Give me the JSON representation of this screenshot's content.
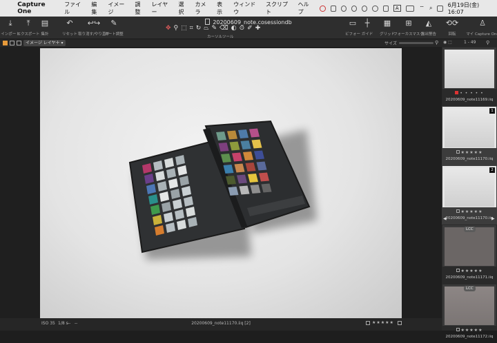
{
  "menubar": {
    "app_name": "Capture One",
    "menus": [
      "ファイル",
      "編集",
      "イメージ",
      "調整",
      "レイヤー",
      "選択",
      "カメラ",
      "表示",
      "ウィンドウ",
      "スクリプト",
      "ヘルプ"
    ],
    "ime": "A",
    "datetime": "6月19日(金)  16:07"
  },
  "toolbar": {
    "document_title": "20200609_note.cosessiondb",
    "left_tools": [
      {
        "label": "インポート",
        "icon": "import-icon"
      },
      {
        "label": "エクスポート",
        "icon": "export-icon"
      },
      {
        "label": "集計",
        "icon": "batch-icon"
      },
      {
        "label": "リセット",
        "icon": "reset-icon"
      },
      {
        "label": "取り消す/やり直す",
        "icon": "undo-redo-icon"
      },
      {
        "label": "オート調整",
        "icon": "auto-adjust-icon"
      }
    ],
    "cursor_tools_label": "カーソルツール",
    "right_tools": [
      {
        "label": "ビフォー",
        "icon": "before-icon"
      },
      {
        "label": "ガイド",
        "icon": "guide-icon"
      },
      {
        "label": "グリッド",
        "icon": "grid-icon"
      },
      {
        "label": "フォーカスマスク",
        "icon": "focus-mask-icon"
      },
      {
        "label": "露出警告",
        "icon": "exposure-warning-icon"
      },
      {
        "label": "回転",
        "icon": "rotate-icon"
      },
      {
        "label": "マイ Capture One",
        "icon": "user-icon"
      }
    ]
  },
  "viewer_bar": {
    "layer_selector": "イメージ レイヤー",
    "size_label": "サイズ",
    "image_count": "1 - 49"
  },
  "status": {
    "iso": "ISO 35",
    "shutter": "1/8 s",
    "dash1": "--",
    "dash2": "--",
    "filename": "20200609_note11170.iiq [2]",
    "stars": "★★★★★"
  },
  "browser": {
    "thumbnails": [
      {
        "name": "20200609_note11169.iiq",
        "stars": "• • • • •",
        "flag": "red",
        "type": "light"
      },
      {
        "name": "20200609_note11170.iiq",
        "stars": "★★★★★",
        "flag": "",
        "badge": "1",
        "type": "light",
        "selected": true
      },
      {
        "name": "20200609_note11170.iiq",
        "stars": "★★★★★",
        "flag": "",
        "badge": "2",
        "type": "light",
        "selected": true
      },
      {
        "name": "20200609_note11171.iiq",
        "stars": "★★★★★",
        "flag": "",
        "lcc": "LCC",
        "type": "dark"
      },
      {
        "name": "20200609_note11172.iiq",
        "stars": "★★★★★",
        "flag": "",
        "lcc": "LCC",
        "type": "dark2"
      }
    ]
  },
  "colors": {
    "accent_orange": "#e79a3a",
    "flag_red": "#dd3333"
  },
  "colorchecker_swatches": [
    "#6e9a8a",
    "#b98a3a",
    "#4e7ba9",
    "#b5508a",
    "#7d3f7e",
    "#8d9a3c",
    "#4b7fa0",
    "#e4c14a",
    "#5d8f4e",
    "#c7426a",
    "#d0883a",
    "#3e4e97",
    "#3b7fad",
    "#c8884e",
    "#a8453c",
    "#5a6a9a",
    "#4c5a2f",
    "#6b4a7d",
    "#e6c53d",
    "#c04e4c",
    "#8a9bb1",
    "#b8b8b8",
    "#8f8f8f",
    "#636363"
  ]
}
